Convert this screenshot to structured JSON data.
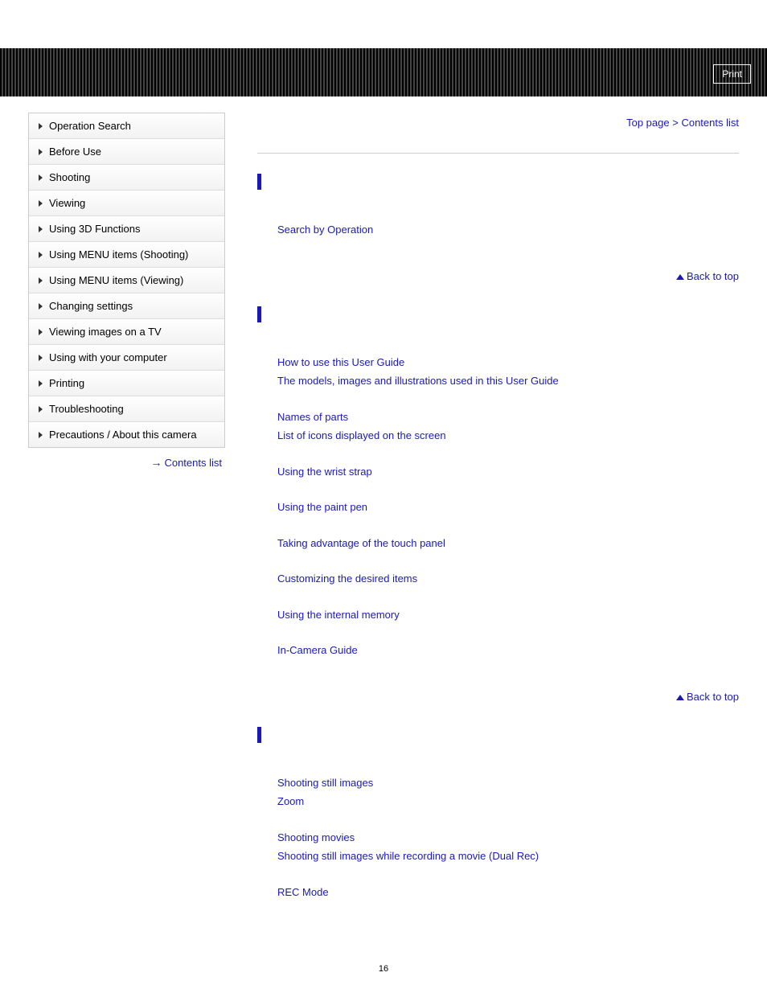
{
  "header": {
    "print_label": "Print"
  },
  "breadcrumb": {
    "top_page": "Top page",
    "separator": ">",
    "contents_list": "Contents list"
  },
  "sidebar": {
    "items": [
      "Operation Search",
      "Before Use",
      "Shooting",
      "Viewing",
      "Using 3D Functions",
      "Using MENU items (Shooting)",
      "Using MENU items (Viewing)",
      "Changing settings",
      "Viewing images on a TV",
      "Using with your computer",
      "Printing",
      "Troubleshooting",
      "Precautions / About this camera"
    ],
    "contents_list_label": "Contents list"
  },
  "sections": {
    "s1": {
      "group1": {
        "link1": "Search by Operation"
      }
    },
    "s2": {
      "group1": {
        "link1": "How to use this User Guide",
        "link2": "The models, images and illustrations used in this User Guide"
      },
      "group2": {
        "link1": "Names of parts",
        "link2": "List of icons displayed on the screen"
      },
      "group3": {
        "link1": "Using the wrist strap"
      },
      "group4": {
        "link1": "Using the paint pen"
      },
      "group5": {
        "link1": "Taking advantage of the touch panel"
      },
      "group6": {
        "link1": "Customizing the desired items"
      },
      "group7": {
        "link1": "Using the internal memory"
      },
      "group8": {
        "link1": "In-Camera Guide"
      }
    },
    "s3": {
      "group1": {
        "link1": "Shooting still images",
        "link2": "Zoom"
      },
      "group2": {
        "link1": "Shooting movies",
        "link2": "Shooting still images while recording a movie (Dual Rec)"
      },
      "group3": {
        "link1": "REC Mode"
      }
    }
  },
  "back_to_top_label": "Back to top",
  "page_number": "16"
}
